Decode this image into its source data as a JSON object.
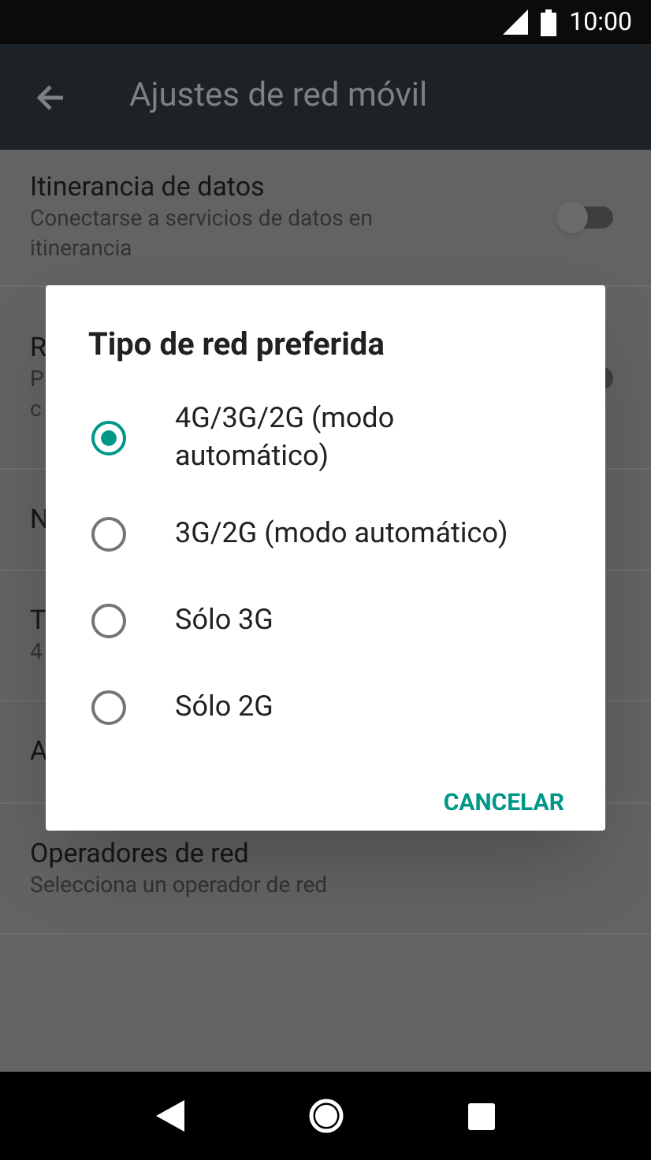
{
  "status_bar": {
    "time": "10:00"
  },
  "app_bar": {
    "title": "Ajustes de red móvil"
  },
  "settings": [
    {
      "title": "Itinerancia de datos",
      "subtitle": [
        "Conectarse a servicios de datos en",
        "itinerancia"
      ],
      "toggle": {
        "on": false
      }
    },
    {
      "title": "R",
      "subtitle": [
        "P",
        "c"
      ],
      "toggle": {
        "on": false
      }
    },
    {
      "title": "N"
    },
    {
      "title": "T",
      "subtitle": [
        "4"
      ]
    },
    {
      "title": "A"
    },
    {
      "title": "Operadores de red",
      "subtitle": [
        "Selecciona un operador de red"
      ]
    }
  ],
  "dialog": {
    "title": "Tipo de red preferida",
    "options": [
      {
        "label": "4G/3G/2G (modo automático)",
        "selected": true
      },
      {
        "label": "3G/2G (modo automático)",
        "selected": false
      },
      {
        "label": "Sólo 3G",
        "selected": false
      },
      {
        "label": "Sólo 2G",
        "selected": false
      }
    ],
    "button": "CANCELAR"
  }
}
